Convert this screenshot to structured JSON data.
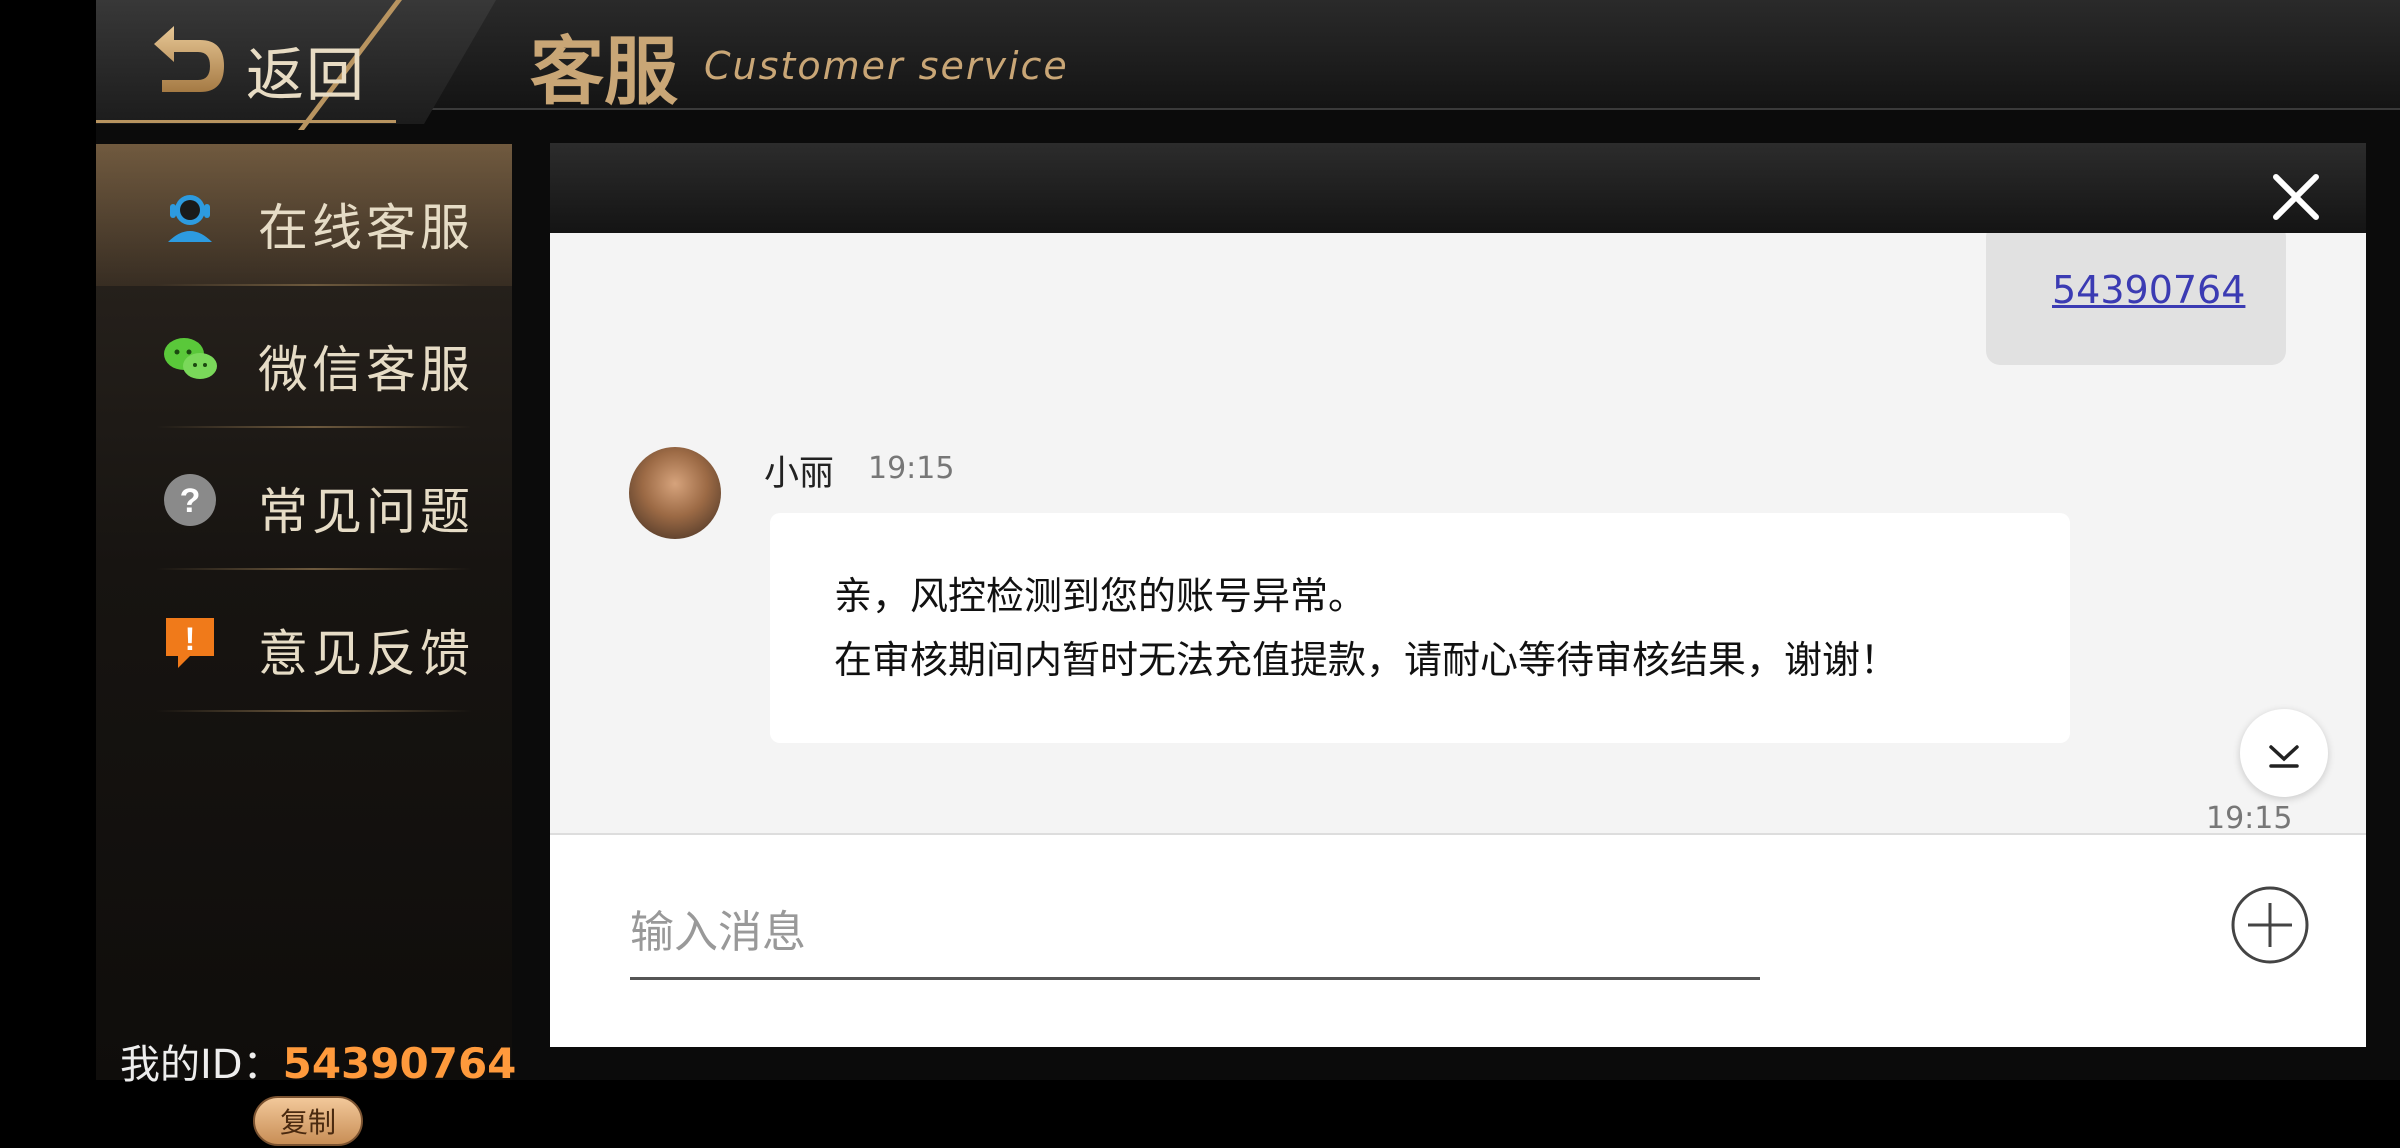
{
  "header": {
    "back_label": "返回",
    "title_cn": "客服",
    "title_en": "Customer service"
  },
  "sidebar": {
    "items": [
      {
        "label": "在线客服",
        "icon": "customer-service-icon",
        "active": true
      },
      {
        "label": "微信客服",
        "icon": "wechat-icon",
        "active": false
      },
      {
        "label": "常见问题",
        "icon": "question-icon",
        "active": false
      },
      {
        "label": "意见反馈",
        "icon": "feedback-icon",
        "active": false
      }
    ],
    "my_id_label": "我的ID：",
    "my_id_value": "54390764",
    "copy_label": "复制"
  },
  "chat": {
    "my_message": "54390764",
    "agent_name": "小丽",
    "agent_time": "19:15",
    "agent_message_line1": "亲，风控检测到您的账号异常。",
    "agent_message_line2": "在审核期间内暂时无法充值提款，请耐心等待审核结果，谢谢！",
    "bottom_time": "19:15",
    "input_placeholder": "输入消息"
  },
  "colors": {
    "accent_gold": "#c9a676",
    "id_orange": "#ff9a3c",
    "link_blue": "#3b3bb3"
  }
}
